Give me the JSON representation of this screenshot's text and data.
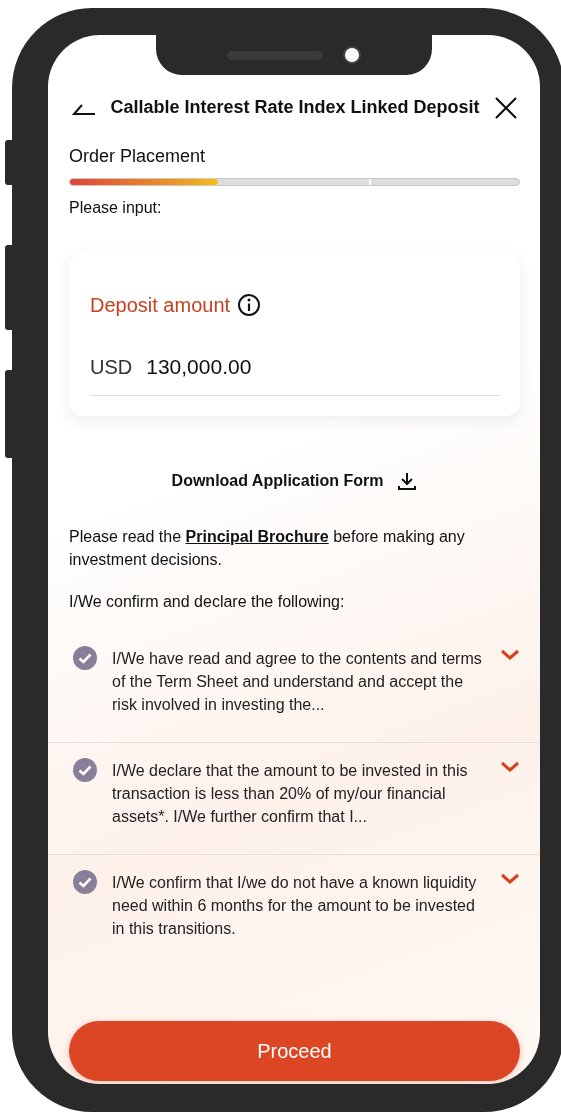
{
  "header": {
    "title": "Callable Interest Rate Index Linked Deposit"
  },
  "progress": {
    "label": "Order Placement",
    "level": 0.33
  },
  "prompt": "Please input:",
  "deposit": {
    "label": "Deposit amount",
    "currency": "USD",
    "value": "130,000.00"
  },
  "download_link": "Download Application Form",
  "notice": {
    "before": "Please read the",
    "link": "Principal Brochure",
    "after": "before making any investment decisions."
  },
  "declaration_intro": "I/We confirm and declare the following:",
  "declarations": [
    {
      "text": "I/We have read and agree to the contents and terms of the Term Sheet and understand and accept the risk involved in investing the...",
      "checked": true,
      "expanded": false
    },
    {
      "text": "I/We declare that the amount to be invested in this transaction is less than 20% of my/our financial assets*. I/We further confirm that I...",
      "checked": true,
      "expanded": false
    },
    {
      "text": "I/We confirm that I/we do not have a known liquidity need within 6 months for the amount to be invested in this transitions.",
      "checked": true,
      "expanded": false
    }
  ],
  "proceed_button": "Proceed"
}
